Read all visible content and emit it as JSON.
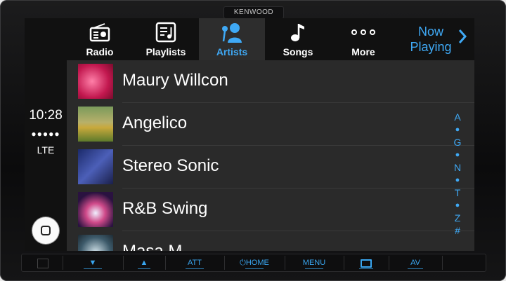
{
  "device": {
    "brand": "KENWOOD"
  },
  "status": {
    "time": "10:28",
    "signal": "●●●●●",
    "network": "LTE"
  },
  "tabs": [
    {
      "label": "Radio",
      "icon": "radio-icon",
      "active": false
    },
    {
      "label": "Playlists",
      "icon": "playlist-icon",
      "active": false
    },
    {
      "label": "Artists",
      "icon": "artist-icon",
      "active": true
    },
    {
      "label": "Songs",
      "icon": "music-note-icon",
      "active": false
    },
    {
      "label": "More",
      "icon": "more-icon",
      "active": false
    }
  ],
  "now_playing": {
    "line1": "Now",
    "line2": "Playing"
  },
  "artists": [
    {
      "name": "Maury Willcon"
    },
    {
      "name": "Angelico"
    },
    {
      "name": "Stereo Sonic"
    },
    {
      "name": "R&B Swing"
    },
    {
      "name": "Masa  M"
    }
  ],
  "index": [
    "A",
    "●",
    "G",
    "●",
    "N",
    "●",
    "T",
    "●",
    "Z",
    "#"
  ],
  "hardware_buttons": [
    {
      "label": "",
      "icon": "square-icon"
    },
    {
      "label": "▼",
      "icon": "down-arrow-icon"
    },
    {
      "label": "▲",
      "icon": "up-arrow-icon"
    },
    {
      "label": "ATT",
      "icon": ""
    },
    {
      "label": "⏻HOME",
      "icon": "power-icon"
    },
    {
      "label": "MENU",
      "icon": ""
    },
    {
      "label": "",
      "icon": "screen-icon"
    },
    {
      "label": "AV",
      "icon": ""
    },
    {
      "label": "",
      "icon": ""
    }
  ],
  "colors": {
    "accent": "#3fa9f5",
    "tabbar": "#111111",
    "list_bg": "#2a2a2a"
  }
}
